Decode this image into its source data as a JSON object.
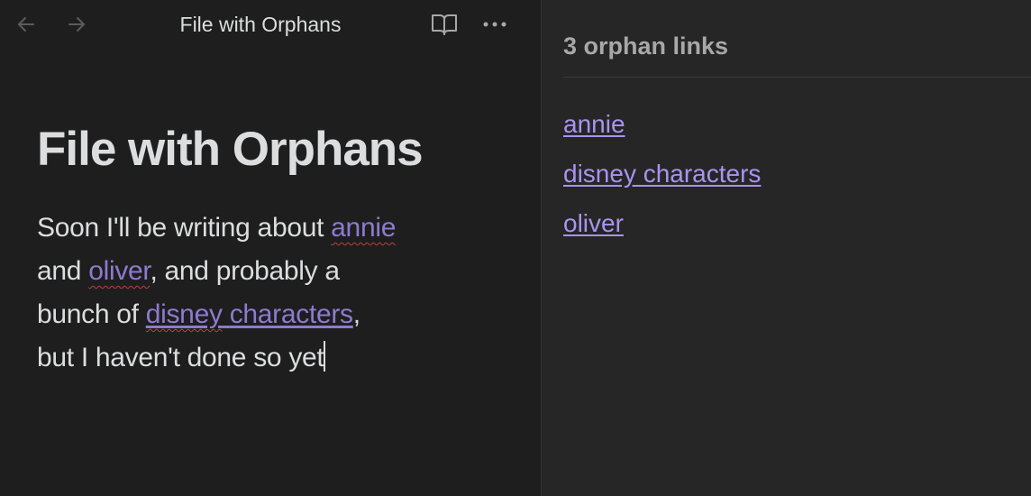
{
  "editor": {
    "nav": {
      "back_icon": "arrow-left-icon",
      "forward_icon": "arrow-right-icon"
    },
    "view_title": "File with Orphans",
    "actions": {
      "reading_icon": "book-open-icon",
      "more_icon": "more-horizontal-icon"
    },
    "document": {
      "title": "File with Orphans",
      "line1_text": "Soon I'll be writing about ",
      "link_annie": "annie",
      "line2_a": "and ",
      "link_oliver": "oliver",
      "line2_b": ", and probably a",
      "line3_a": "bunch of ",
      "link_disney_1": "disney",
      "link_disney_sep": " ",
      "link_disney_2": "characters",
      "line3_b": ",",
      "line4": "but I haven't done so yet"
    }
  },
  "sidebar": {
    "header": "3 orphan links",
    "links": [
      "annie",
      "disney characters",
      "oliver"
    ]
  },
  "colors": {
    "background": "#1e1e1e",
    "sidebar_background": "#262626",
    "text": "#dcddde",
    "link_editor": "#8d7bd0",
    "link_sidebar": "#a993f1",
    "spellcheck": "#c0413f"
  }
}
